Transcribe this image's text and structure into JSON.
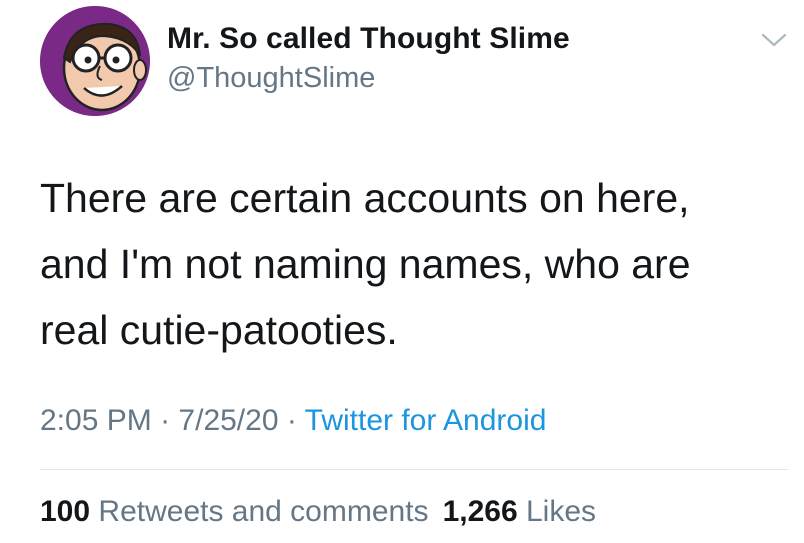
{
  "author": {
    "display_name": "Mr. So called Thought Slime",
    "handle": "@ThoughtSlime",
    "avatar_icon": "cartoon-face-avatar"
  },
  "tweet": {
    "lines": [
      "There are certain accounts on here,",
      "and I'm not naming names, who are",
      "real cutie-patooties."
    ]
  },
  "meta": {
    "time": "2:05 PM",
    "separator": "·",
    "date": "7/25/20",
    "source": "Twitter for Android"
  },
  "stats": {
    "retweets_count": "100",
    "retweets_label": "Retweets and comments",
    "likes_count": "1,266",
    "likes_label": "Likes"
  },
  "colors": {
    "link": "#1b95e0",
    "muted": "#657786",
    "text": "#14171a",
    "divider": "#e1e8ed",
    "avatar_bg": "#7a2a86"
  }
}
